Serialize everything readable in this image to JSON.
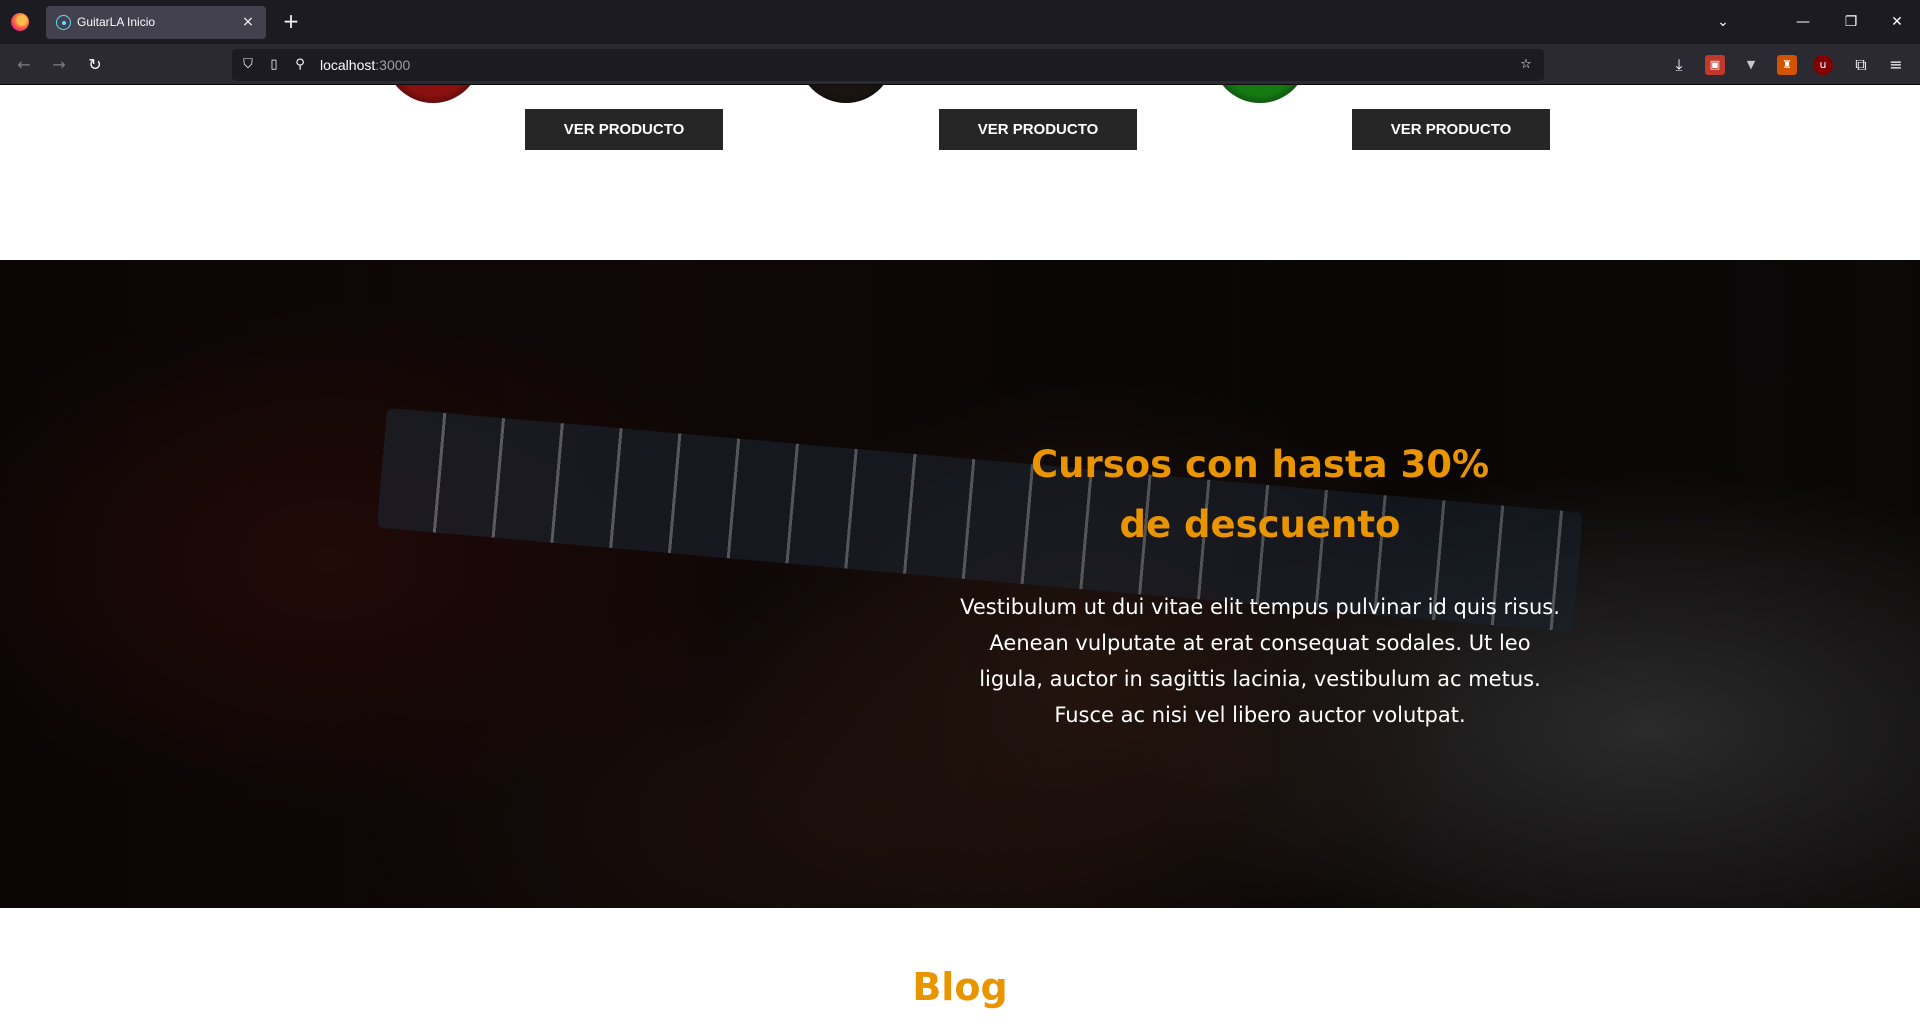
{
  "browser": {
    "tab_title": "GuitarLA Inicio",
    "tab_close": "×",
    "new_tab": "+",
    "url_host": "localhost",
    "url_port": ":3000",
    "icons": [
      "firefox-logo",
      "react-favicon",
      "back-arrow-icon",
      "forward-arrow-icon",
      "reload-icon",
      "shield-icon",
      "page-icon",
      "site-permissions-icon",
      "bookmark-star-icon",
      "download-icon",
      "extensions-icon",
      "menu-icon"
    ]
  },
  "products": {
    "button_label": "Ver Producto",
    "guitar_colors": [
      "#8b1010",
      "#1a1410",
      "#157a12"
    ]
  },
  "promo": {
    "title": "Cursos con hasta 30% de descuento",
    "text": "Vestibulum ut dui vitae elit tempus pulvinar id quis risus. Aenean vulputate at erat consequat sodales. Ut leo ligula, auctor in sagittis lacinia, vestibulum ac metus. Fusce ac nisi vel libero auctor volutpat."
  },
  "blog": {
    "title": "Blog"
  },
  "colors": {
    "accent": "#e99401",
    "button_bg": "#262626"
  }
}
